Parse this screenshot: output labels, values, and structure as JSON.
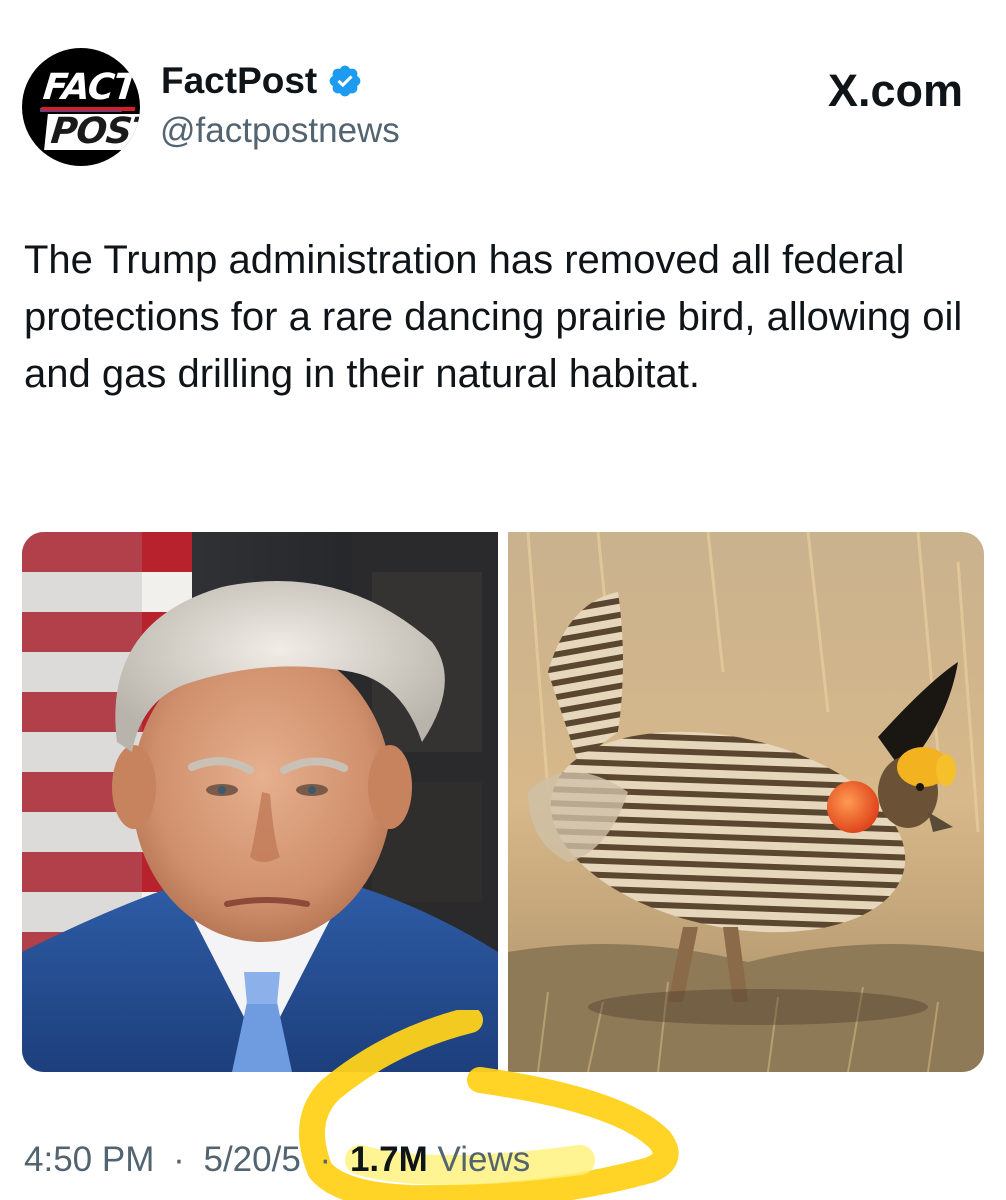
{
  "header": {
    "avatar_alt": "FactPost logo",
    "avatar_text_top": "FACT",
    "avatar_text_bottom": "POST",
    "display_name": "FactPost",
    "handle": "@factpostnews",
    "site_label": "X.com",
    "verified_icon": "verified-badge-icon"
  },
  "tweet": {
    "text": "The Trump administration has removed all federal protections for a rare dancing prairie bird, allowing oil and gas drilling in their natural habitat."
  },
  "media": [
    {
      "name": "portrait-photo"
    },
    {
      "name": "prairie-chicken-photo"
    }
  ],
  "meta": {
    "time": "4:50 PM",
    "separator": "·",
    "date_visible": "5/20",
    "date_obscured": "/",
    "date_tail": "5",
    "views_count": "1.7M",
    "views_label": "Views"
  },
  "colors": {
    "text_primary": "#0f1419",
    "text_secondary": "#536471",
    "verified_blue": "#1d9bf0",
    "highlight_yellow": "#ffd21a"
  }
}
